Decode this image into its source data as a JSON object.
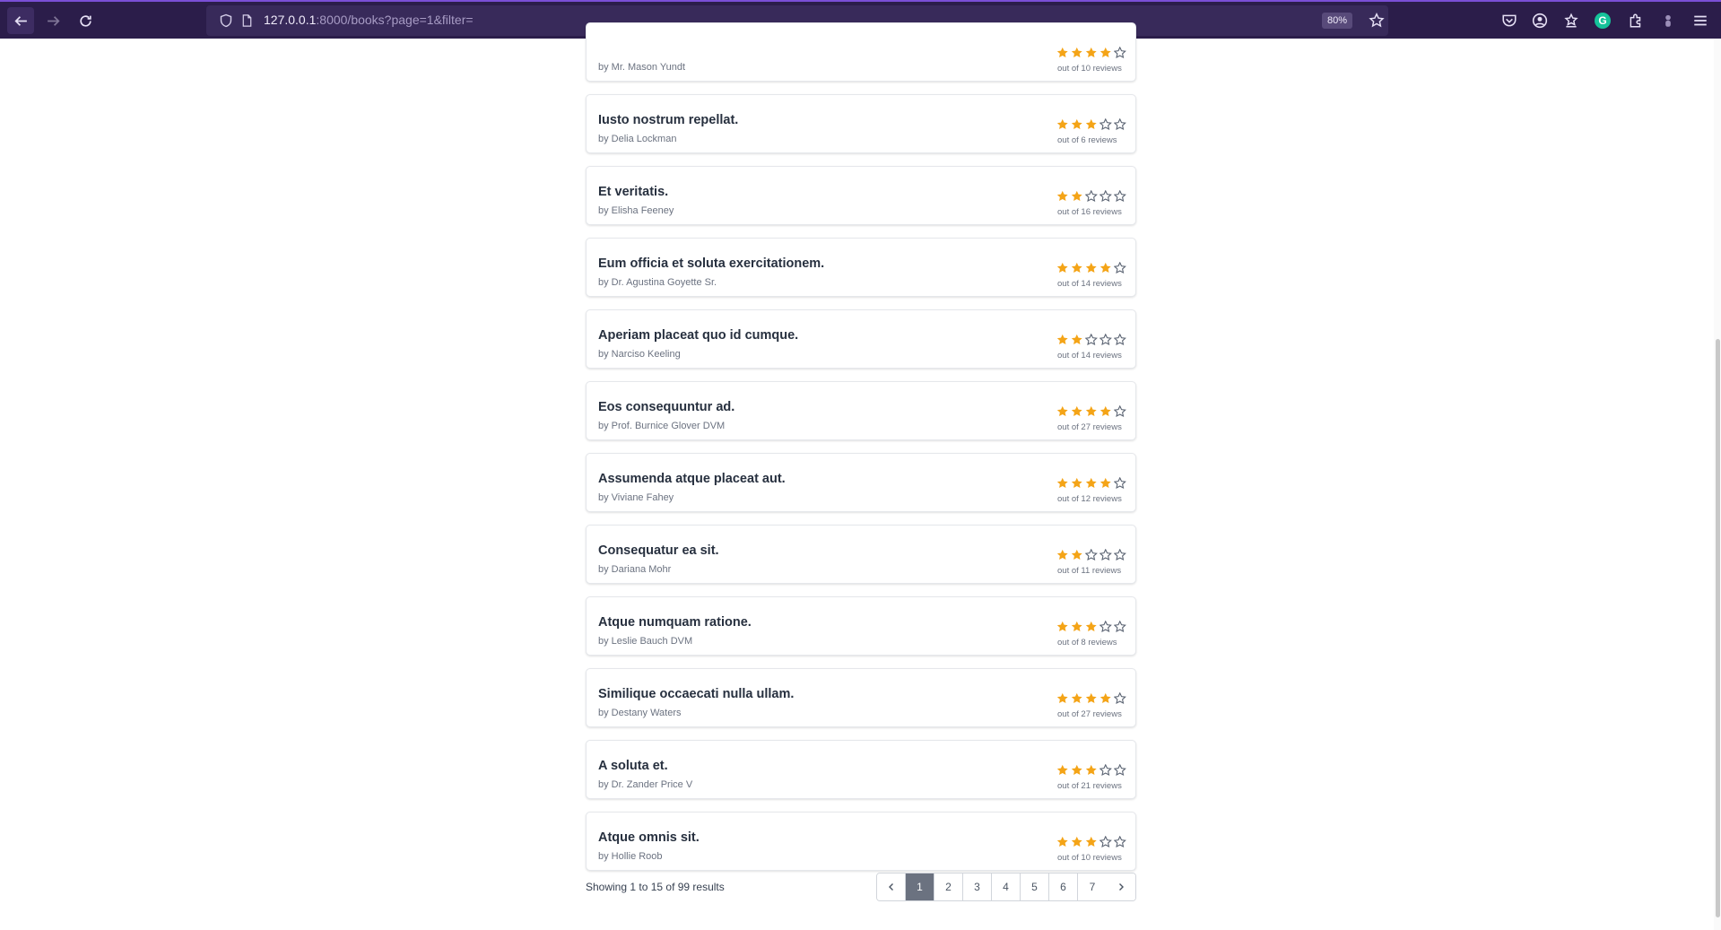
{
  "browser": {
    "url_host": "127.0.0.1",
    "url_rest": ":8000/books?page=1&filter=",
    "zoom": "80%"
  },
  "books": [
    {
      "title": "",
      "author": "by Mr. Mason Yundt",
      "rating": 4,
      "reviews": "out of 10 reviews"
    },
    {
      "title": "Iusto nostrum repellat.",
      "author": "by Delia Lockman",
      "rating": 3,
      "reviews": "out of 6 reviews"
    },
    {
      "title": "Et veritatis.",
      "author": "by Elisha Feeney",
      "rating": 2,
      "reviews": "out of 16 reviews"
    },
    {
      "title": "Eum officia et soluta exercitationem.",
      "author": "by Dr. Agustina Goyette Sr.",
      "rating": 4,
      "reviews": "out of 14 reviews"
    },
    {
      "title": "Aperiam placeat quo id cumque.",
      "author": "by Narciso Keeling",
      "rating": 2,
      "reviews": "out of 14 reviews"
    },
    {
      "title": "Eos consequuntur ad.",
      "author": "by Prof. Burnice Glover DVM",
      "rating": 4,
      "reviews": "out of 27 reviews"
    },
    {
      "title": "Assumenda atque placeat aut.",
      "author": "by Viviane Fahey",
      "rating": 4,
      "reviews": "out of 12 reviews"
    },
    {
      "title": "Consequatur ea sit.",
      "author": "by Dariana Mohr",
      "rating": 2,
      "reviews": "out of 11 reviews"
    },
    {
      "title": "Atque numquam ratione.",
      "author": "by Leslie Bauch DVM",
      "rating": 3,
      "reviews": "out of 8 reviews"
    },
    {
      "title": "Similique occaecati nulla ullam.",
      "author": "by Destany Waters",
      "rating": 4,
      "reviews": "out of 27 reviews"
    },
    {
      "title": "A soluta et.",
      "author": "by Dr. Zander Price V",
      "rating": 3,
      "reviews": "out of 21 reviews"
    },
    {
      "title": "Atque omnis sit.",
      "author": "by Hollie Roob",
      "rating": 3,
      "reviews": "out of 10 reviews"
    }
  ],
  "footer": {
    "results_text": "Showing 1 to 15 of 99 results"
  },
  "pagination": {
    "pages": [
      "1",
      "2",
      "3",
      "4",
      "5",
      "6",
      "7"
    ],
    "current": "1"
  },
  "colors": {
    "star_filled": "#f4a417",
    "star_empty": "#5b6473",
    "chrome_bg": "#2b1d4a"
  }
}
